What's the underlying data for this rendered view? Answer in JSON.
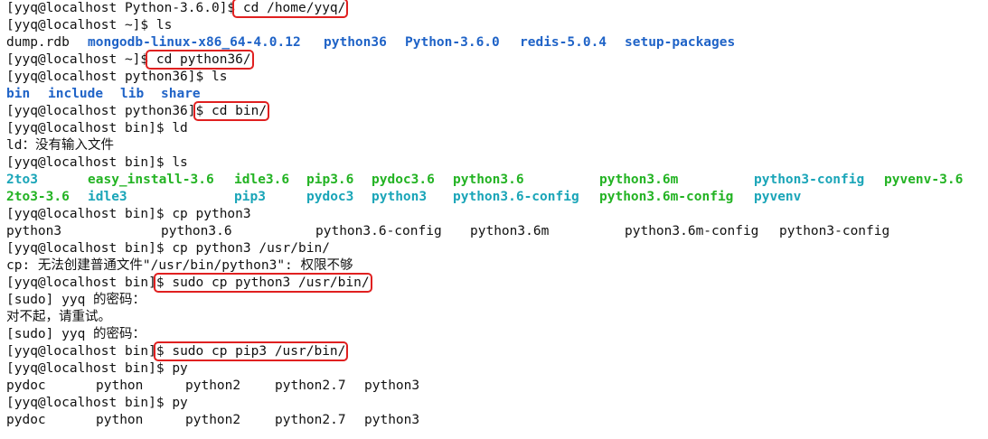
{
  "terminal": {
    "lines": [
      {
        "parts": [
          {
            "t": "[yyq@localhost Python-3.6.0]$"
          },
          {
            "t": " cd /home/yyq/",
            "hl": true
          }
        ]
      },
      {
        "parts": [
          {
            "t": "[yyq@localhost ~]$ ls"
          }
        ]
      },
      {
        "cols": [
          {
            "t": "dump.rdb",
            "w": 90
          },
          {
            "t": "mongodb-linux-x86_64-4.0.12",
            "w": 261,
            "c": "dir-blue"
          },
          {
            "t": "python36",
            "w": 90,
            "c": "dir-blue"
          },
          {
            "t": "Python-3.6.0",
            "w": 127,
            "c": "dir-blue"
          },
          {
            "t": "redis-5.0.4",
            "w": 116,
            "c": "dir-blue"
          },
          {
            "t": "setup-packages",
            "w": 140,
            "c": "dir-blue"
          }
        ]
      },
      {
        "parts": [
          {
            "t": "[yyq@localhost ~]$"
          },
          {
            "t": " cd python36/",
            "hl": true
          }
        ]
      },
      {
        "parts": [
          {
            "t": "[yyq@localhost python36]$ ls"
          }
        ]
      },
      {
        "cols": [
          {
            "t": "bin",
            "w": 46,
            "c": "dir-blue"
          },
          {
            "t": "include",
            "w": 80,
            "c": "dir-blue"
          },
          {
            "t": "lib",
            "w": 45,
            "c": "dir-blue"
          },
          {
            "t": "share",
            "w": 60,
            "c": "dir-blue"
          }
        ]
      },
      {
        "parts": [
          {
            "t": "[yyq@localhost python36]"
          },
          {
            "t": "$ cd bin/",
            "hl": true
          }
        ]
      },
      {
        "parts": [
          {
            "t": "[yyq@localhost bin]$ ld"
          }
        ]
      },
      {
        "parts": [
          {
            "t": "ld：没有输入文件"
          }
        ]
      },
      {
        "parts": [
          {
            "t": "[yyq@localhost bin]$ ls"
          }
        ]
      },
      {
        "cols": [
          {
            "t": "2to3",
            "w": 90,
            "c": "link-teal"
          },
          {
            "t": "easy_install-3.6",
            "w": 162,
            "c": "exec-green"
          },
          {
            "t": "idle3.6",
            "w": 80,
            "c": "exec-green"
          },
          {
            "t": "pip3.6",
            "w": 72,
            "c": "exec-green"
          },
          {
            "t": "pydoc3.6",
            "w": 90,
            "c": "exec-green"
          },
          {
            "t": "python3.6",
            "w": 162,
            "c": "exec-green"
          },
          {
            "t": "python3.6m",
            "w": 171,
            "c": "exec-green"
          },
          {
            "t": "python3-config",
            "w": 144,
            "c": "link-teal"
          },
          {
            "t": "pyvenv-3.6",
            "w": 100,
            "c": "exec-green"
          }
        ]
      },
      {
        "cols": [
          {
            "t": "2to3-3.6",
            "w": 90,
            "c": "exec-green"
          },
          {
            "t": "idle3",
            "w": 162,
            "c": "link-teal"
          },
          {
            "t": "pip3",
            "w": 80,
            "c": "link-teal"
          },
          {
            "t": "pydoc3",
            "w": 72,
            "c": "link-teal"
          },
          {
            "t": "python3",
            "w": 90,
            "c": "link-teal"
          },
          {
            "t": "python3.6-config",
            "w": 162,
            "c": "link-teal"
          },
          {
            "t": "python3.6m-config",
            "w": 171,
            "c": "exec-green"
          },
          {
            "t": "pyvenv",
            "w": 100,
            "c": "link-teal"
          }
        ]
      },
      {
        "parts": [
          {
            "t": "[yyq@localhost bin]$ cp python3"
          }
        ]
      },
      {
        "cols": [
          {
            "t": "python3",
            "w": 171
          },
          {
            "t": "python3.6",
            "w": 171
          },
          {
            "t": "python3.6-config",
            "w": 171
          },
          {
            "t": "python3.6m",
            "w": 171
          },
          {
            "t": "python3.6m-config",
            "w": 171
          },
          {
            "t": "python3-config",
            "w": 140
          }
        ]
      },
      {
        "parts": [
          {
            "t": "[yyq@localhost bin]$ cp python3 /usr/bin/"
          }
        ]
      },
      {
        "parts": [
          {
            "t": "cp: 无法创建普通文件\"/usr/bin/python3\": 权限不够"
          }
        ]
      },
      {
        "parts": [
          {
            "t": "[yyq@localhost bin]"
          },
          {
            "t": "$ sudo cp python3 /usr/bin/",
            "hl": true
          }
        ]
      },
      {
        "parts": [
          {
            "t": "[sudo] yyq 的密码："
          }
        ]
      },
      {
        "parts": [
          {
            "t": "对不起，请重试。"
          }
        ]
      },
      {
        "parts": [
          {
            "t": "[sudo] yyq 的密码："
          }
        ]
      },
      {
        "parts": [
          {
            "t": "[yyq@localhost bin]"
          },
          {
            "t": "$ sudo cp pip3 /usr/bin/",
            "hl": true
          }
        ]
      },
      {
        "parts": [
          {
            "t": "[yyq@localhost bin]$ py"
          }
        ]
      },
      {
        "cols": [
          {
            "t": "pydoc",
            "w": 99
          },
          {
            "t": "python",
            "w": 99
          },
          {
            "t": "python2",
            "w": 99
          },
          {
            "t": "python2.7",
            "w": 99
          },
          {
            "t": "python3",
            "w": 99
          }
        ]
      },
      {
        "parts": [
          {
            "t": "[yyq@localhost bin]$ py"
          }
        ]
      },
      {
        "cols": [
          {
            "t": "pydoc",
            "w": 99
          },
          {
            "t": "python",
            "w": 99
          },
          {
            "t": "python2",
            "w": 99
          },
          {
            "t": "python2.7",
            "w": 99
          },
          {
            "t": "python3",
            "w": 99
          }
        ]
      }
    ]
  }
}
